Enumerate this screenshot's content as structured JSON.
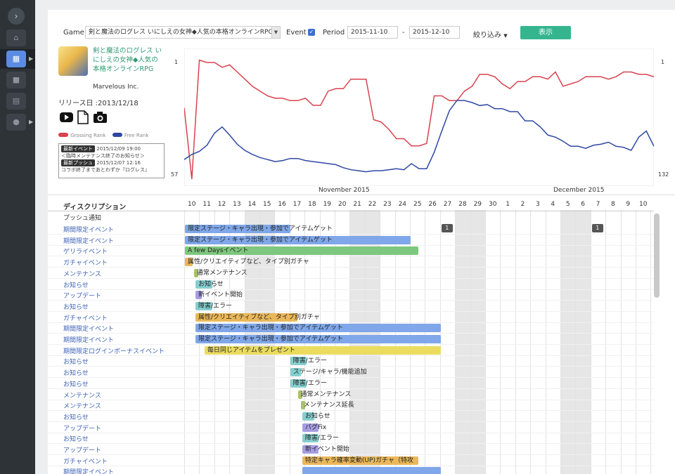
{
  "header": {
    "game_label": "Game",
    "game_value": "剣と魔法のログレス いにしえの女神◆人気の本格オンラインRPG",
    "event_label": "Event",
    "event_checked": true,
    "period_label": "Period",
    "date_from": "2015-11-10",
    "date_sep": "-",
    "date_to": "2015-12-10",
    "filter_label": "絞り込み",
    "show_button": "表示"
  },
  "game": {
    "title": "剣と魔法のログレス いにしえの女神◆人気の本格オンラインRPG",
    "publisher": "Marvelous Inc.",
    "release": "リリース日 :2013/12/18",
    "media_icons": [
      "youtube-icon",
      "document-icon",
      "camera-icon"
    ]
  },
  "legend": {
    "grossing": "Grossing Rank",
    "free": "Free Rank",
    "grossing_color": "#d9424e",
    "free_color": "#2f47a3"
  },
  "info": {
    "latest_event_badge": "最新イベント",
    "latest_event_date": "2015/12/09 19:00",
    "latest_event_text": "＜臨時メンテナンス終了のお知らせ＞",
    "latest_push_badge": "最新プッシュ",
    "latest_push_date": "2015/12/07 12:16",
    "latest_push_text": "コラボ終了まであとわずか『ログレス』"
  },
  "chart_data": {
    "type": "line",
    "x": [
      "2015-11-10",
      "2015-12-10"
    ],
    "month_labels": [
      "November 2015",
      "December 2015"
    ],
    "left_axis": [
      "1",
      "57"
    ],
    "right_axis": [
      "1",
      "132"
    ],
    "series": [
      {
        "name": "Grossing Rank",
        "axis": "left",
        "color": "#d9424e",
        "values": [
          25,
          55,
          5,
          6,
          6,
          8,
          7,
          10,
          13,
          16,
          18,
          20,
          21,
          21,
          22,
          22,
          21,
          24,
          24,
          18,
          17,
          17,
          13,
          13,
          13,
          30,
          31,
          34,
          38,
          38,
          41,
          41,
          40,
          20,
          20,
          22,
          22,
          18,
          16,
          11,
          11,
          12,
          15,
          17,
          14,
          14,
          12,
          12,
          13,
          10,
          16,
          15,
          14,
          12,
          12,
          12,
          13,
          12,
          10,
          10,
          11,
          11,
          12
        ]
      },
      {
        "name": "Free Rank",
        "axis": "right",
        "color": "#2f47a3",
        "values": [
          108,
          103,
          100,
          94,
          82,
          76,
          84,
          93,
          99,
          103,
          106,
          108,
          110,
          109,
          107,
          107,
          109,
          110,
          111,
          112,
          113,
          116,
          118,
          119,
          120,
          119,
          119,
          118,
          117,
          118,
          112,
          117,
          117,
          101,
          80,
          60,
          50,
          50,
          52,
          55,
          54,
          58,
          58,
          61,
          61,
          70,
          70,
          76,
          84,
          86,
          90,
          95,
          95,
          97,
          94,
          93,
          91,
          95,
          96,
          99,
          86,
          80,
          95
        ]
      }
    ],
    "days": [
      "10",
      "11",
      "12",
      "13",
      "14",
      "15",
      "16",
      "17",
      "18",
      "19",
      "20",
      "21",
      "22",
      "23",
      "24",
      "25",
      "26",
      "27",
      "28",
      "29",
      "30",
      "1",
      "2",
      "3",
      "4",
      "5",
      "6",
      "7",
      "8",
      "9",
      "10"
    ],
    "weekend_day_indices": [
      4,
      5,
      11,
      12,
      18,
      19,
      25,
      26
    ],
    "push_counts": [
      {
        "day_index": 17,
        "count": "1"
      },
      {
        "day_index": 27,
        "count": "1"
      }
    ]
  },
  "table": {
    "header_label": "ディスクリプション",
    "push_row_label": "プッシュ通知",
    "rows": [
      {
        "label": "期間限定イベント",
        "bar": "限定ステージ・キャラ出現・参加でアイテムゲット",
        "start": 0,
        "len": 7,
        "color": "blue"
      },
      {
        "label": "期間限定イベント",
        "bar": "限定ステージ・キャラ出現・参加でアイテムゲット",
        "start": 0,
        "len": 15,
        "color": "blue"
      },
      {
        "label": "ゲリライベント",
        "bar": "A few Daysイベント",
        "start": 0,
        "len": 15.5,
        "color": "green"
      },
      {
        "label": "ガチャイベント",
        "bar": "属性/クリエイティブなど、タイプ別ガチャ",
        "start": 0,
        "len": 0.5,
        "color": "orange"
      },
      {
        "label": "メンテナンス",
        "bar": "通常メンテナンス",
        "start": 0.6,
        "len": 0.25,
        "color": "olive"
      },
      {
        "label": "お知らせ",
        "bar": "お知らせ",
        "start": 0.7,
        "len": 1.1,
        "color": "teal"
      },
      {
        "label": "アップデート",
        "bar": "新イベント開始",
        "start": 0.7,
        "len": 0.4,
        "color": "purple"
      },
      {
        "label": "お知らせ",
        "bar": "障害/エラー",
        "start": 0.7,
        "len": 1.1,
        "color": "teal"
      },
      {
        "label": "ガチャイベント",
        "bar": "属性/クリエイティブなど、タイプ別ガチャ",
        "start": 0.7,
        "len": 6.8,
        "color": "orange"
      },
      {
        "label": "期間限定イベント",
        "bar": "限定ステージ・キャラ出現・参加でアイテムゲット",
        "start": 0.7,
        "len": 16.3,
        "color": "blue"
      },
      {
        "label": "期間限定イベント",
        "bar": "限定ステージ・キャラ出現・参加でアイテムゲット",
        "start": 0.7,
        "len": 16.3,
        "color": "blue"
      },
      {
        "label": "期間限定ログインボーナスイベント",
        "bar": "毎日同じアイテムをプレゼント",
        "start": 1.3,
        "len": 15.7,
        "color": "yellow"
      },
      {
        "label": "お知らせ",
        "bar": "障害/エラー",
        "start": 7,
        "len": 1.1,
        "color": "teal"
      },
      {
        "label": "お知らせ",
        "bar": "ステージ/キャラ/機能追加",
        "start": 7,
        "len": 0.7,
        "color": "teal"
      },
      {
        "label": "お知らせ",
        "bar": "障害/エラー",
        "start": 7,
        "len": 1.1,
        "color": "teal"
      },
      {
        "label": "メンテナンス",
        "bar": "通常メンテナンス",
        "start": 7.5,
        "len": 0.25,
        "color": "olive"
      },
      {
        "label": "メンテナンス",
        "bar": "メンテナンス延長",
        "start": 7.7,
        "len": 0.25,
        "color": "olive"
      },
      {
        "label": "お知らせ",
        "bar": "お知らせ",
        "start": 7.8,
        "len": 0.8,
        "color": "teal"
      },
      {
        "label": "アップデート",
        "bar": "バグFix",
        "start": 7.8,
        "len": 1.1,
        "color": "purple"
      },
      {
        "label": "お知らせ",
        "bar": "障害/エラー",
        "start": 7.8,
        "len": 1.1,
        "color": "teal"
      },
      {
        "label": "アップデート",
        "bar": "新イベント開始",
        "start": 7.8,
        "len": 1.1,
        "color": "purple"
      },
      {
        "label": "ガチャイベント",
        "bar": "特定キャラ確率変動(UP)ガチャ（特攻",
        "start": 7.8,
        "len": 7.7,
        "color": "orange"
      },
      {
        "label": "期間限定イベント",
        "bar": "",
        "start": 7.8,
        "len": 9.2,
        "color": "blue"
      }
    ]
  }
}
